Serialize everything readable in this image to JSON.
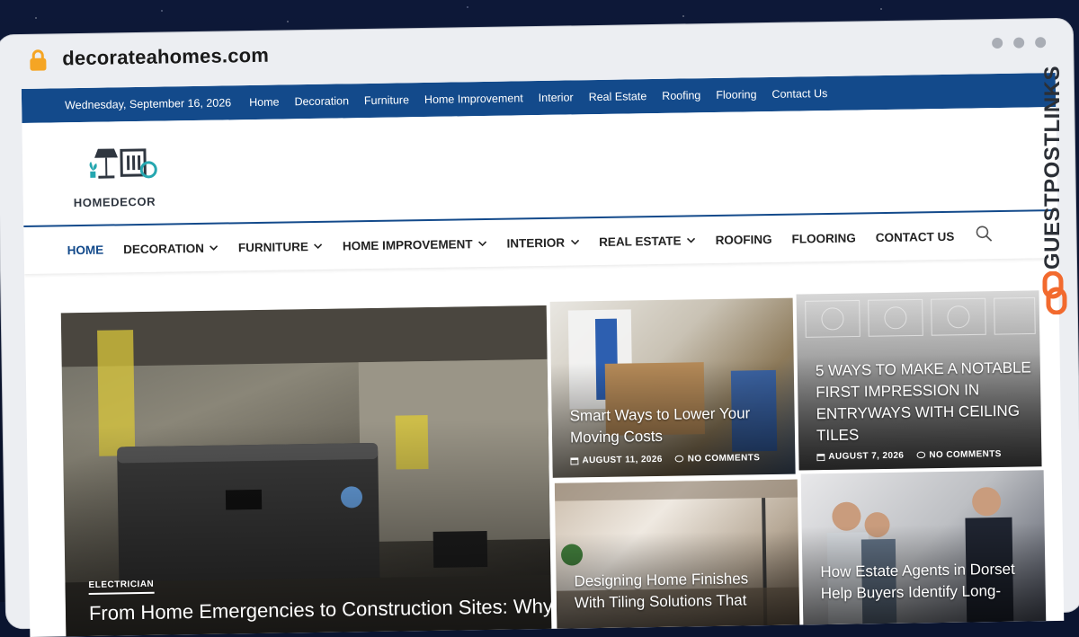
{
  "browser": {
    "url": "decorateahomes.com"
  },
  "watermark": "GUESTPOSTLINKS",
  "topbar": {
    "date": "Wednesday, September 16, 2026",
    "links": [
      "Home",
      "Decoration",
      "Furniture",
      "Home Improvement",
      "Interior",
      "Real Estate",
      "Roofing",
      "Flooring",
      "Contact Us"
    ]
  },
  "logo": {
    "text_home": "HOME",
    "text_decor": "DECOR"
  },
  "nav": {
    "items": [
      "HOME",
      "DECORATION",
      "FURNITURE",
      "HOME IMPROVEMENT",
      "INTERIOR",
      "REAL ESTATE",
      "ROOFING",
      "FLOORING",
      "CONTACT US"
    ]
  },
  "featured": {
    "category": "ELECTRICIAN",
    "title": "From Home Emergencies to Construction Sites: Why"
  },
  "posts": [
    {
      "title": "Smart Ways to Lower Your Moving Costs",
      "date": "AUGUST 11, 2026",
      "comments": "NO COMMENTS"
    },
    {
      "title": "5 WAYS TO MAKE A NOTABLE FIRST IMPRESSION IN ENTRYWAYS WITH CEILING TILES",
      "date": "AUGUST 7, 2026",
      "comments": "NO COMMENTS"
    },
    {
      "title": "Designing Home Finishes With Tiling Solutions That"
    },
    {
      "title": "How Estate Agents in Dorset Help Buyers Identify Long-"
    }
  ],
  "colors": {
    "primary": "#134a8b",
    "accent_orange": "#f26a2e",
    "logo_teal": "#26a7b0"
  }
}
